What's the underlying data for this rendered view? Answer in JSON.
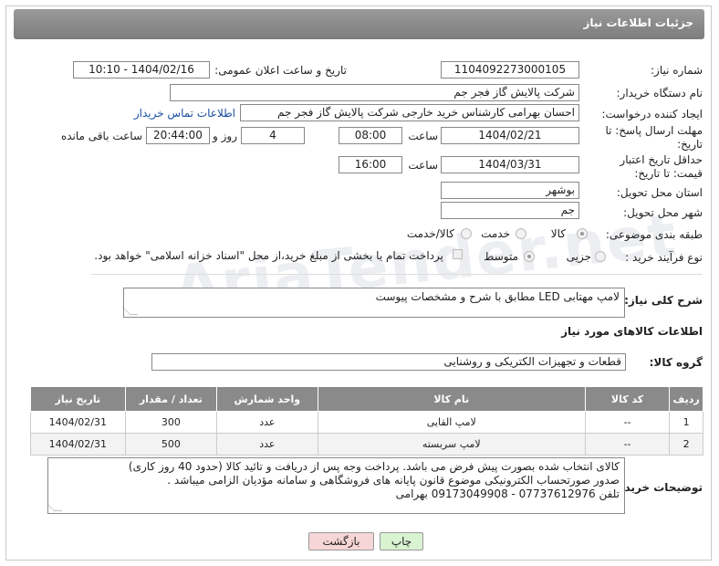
{
  "header": {
    "title": "جزئیات اطلاعات نیاز"
  },
  "fields": {
    "need_number": {
      "label": "شماره نیاز:",
      "value": "1104092273000105"
    },
    "announce_datetime": {
      "label": "تاریخ و ساعت اعلان عمومی:",
      "value": "1404/02/16 - 10:10"
    },
    "buyer_org": {
      "label": "نام دستگاه خریدار:",
      "value": "شرکت پالایش گاز فجر جم"
    },
    "requester": {
      "label": "ایجاد کننده درخواست:",
      "value": "احسان بهرامی کارشناس خرید خارجی شرکت پالایش گاز فجر جم",
      "contact_link": "اطلاعات تماس خریدار"
    },
    "reply_deadline": {
      "label": "مهلت ارسال پاسخ: تا تاریخ:",
      "date": "1404/02/21",
      "time_label": "ساعت",
      "time": "08:00",
      "days": "4",
      "days_label": "روز و",
      "remaining": "20:44:00",
      "remaining_label": "ساعت باقی مانده"
    },
    "price_validity": {
      "label": "حداقل تاریخ اعتبار قیمت: تا تاریخ:",
      "date": "1404/03/31",
      "time_label": "ساعت",
      "time": "16:00"
    },
    "province": {
      "label": "استان محل تحویل:",
      "value": "بوشهر"
    },
    "city": {
      "label": "شهر محل تحویل:",
      "value": "جم"
    },
    "category": {
      "label": "طبقه بندی موضوعی:",
      "options": [
        "کالا",
        "خدمت",
        "کالا/خدمت"
      ],
      "selected": "کالا"
    },
    "purchase_type": {
      "label": "نوع فرآیند خرید :",
      "options": [
        "جزیی",
        "متوسط"
      ],
      "selected": "متوسط",
      "note": "پرداخت تمام یا بخشی از مبلغ خرید،از محل \"اسناد خزانه اسلامی\" خواهد بود."
    },
    "general_desc": {
      "label": "شرح کلی نیاز:",
      "value": "لامپ مهتابی LED  مطابق با شرح و مشخصات پیوست"
    }
  },
  "goods_section": {
    "title": "اطلاعات کالاهای مورد نیاز",
    "group_label": "گروه کالا:",
    "group_value": "قطعات و تجهیزات الکتریکی و روشنایی"
  },
  "table": {
    "headers": [
      "ردیف",
      "کد کالا",
      "نام کالا",
      "واحد شمارش",
      "تعداد / مقدار",
      "تاریخ نیاز"
    ],
    "rows": [
      [
        "1",
        "--",
        "لامپ القایی",
        "عدد",
        "300",
        "1404/02/31"
      ],
      [
        "2",
        "--",
        "لامپ سربسته",
        "عدد",
        "500",
        "1404/02/31"
      ]
    ]
  },
  "buyer_notes": {
    "label": "توضیحات خریدار:",
    "lines": [
      "کالای انتخاب شده بصورت پیش فرض می باشد. پرداخت وجه پس از دریافت و تائید کالا (حدود 40 روز کاری)",
      "صدور صورتحساب الکترونیکی موضوع قانون پایانه های فروشگاهی و سامانه مؤدیان الزامی میباشد .",
      "تلفن 07737612976 - 09173049908 بهرامی"
    ]
  },
  "buttons": {
    "print": "چاپ",
    "back": "بازگشت"
  },
  "watermark": "AriaTender.net",
  "colors": {
    "header_bg": "#8a8a8a",
    "link": "#1a4fa0",
    "print_btn": "#d9f2d0",
    "back_btn": "#f6d6d6"
  }
}
